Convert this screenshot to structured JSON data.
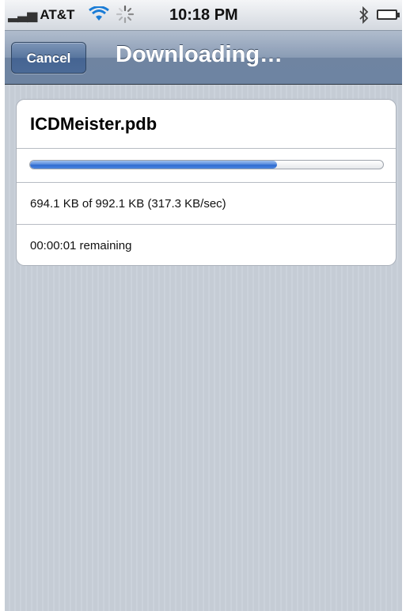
{
  "status_bar": {
    "carrier": "AT&T",
    "time": "10:18 PM",
    "icons": [
      "signal-icon",
      "wifi-icon",
      "activity-spinner-icon",
      "bluetooth-icon",
      "battery-icon"
    ],
    "battery_color": "#3ad12f"
  },
  "nav": {
    "cancel_label": "Cancel",
    "title": "Downloading…"
  },
  "download": {
    "file_name": "ICDMeister.pdb",
    "progress_fraction": 0.7,
    "size_text": "694.1 KB of 992.1 KB (317.3 KB/sec)",
    "remaining_text": "00:00:01 remaining"
  },
  "colors": {
    "nav_bar": "#6f84a1",
    "progress_fill": "#2f6bd0",
    "background": "#c5ccd5"
  }
}
